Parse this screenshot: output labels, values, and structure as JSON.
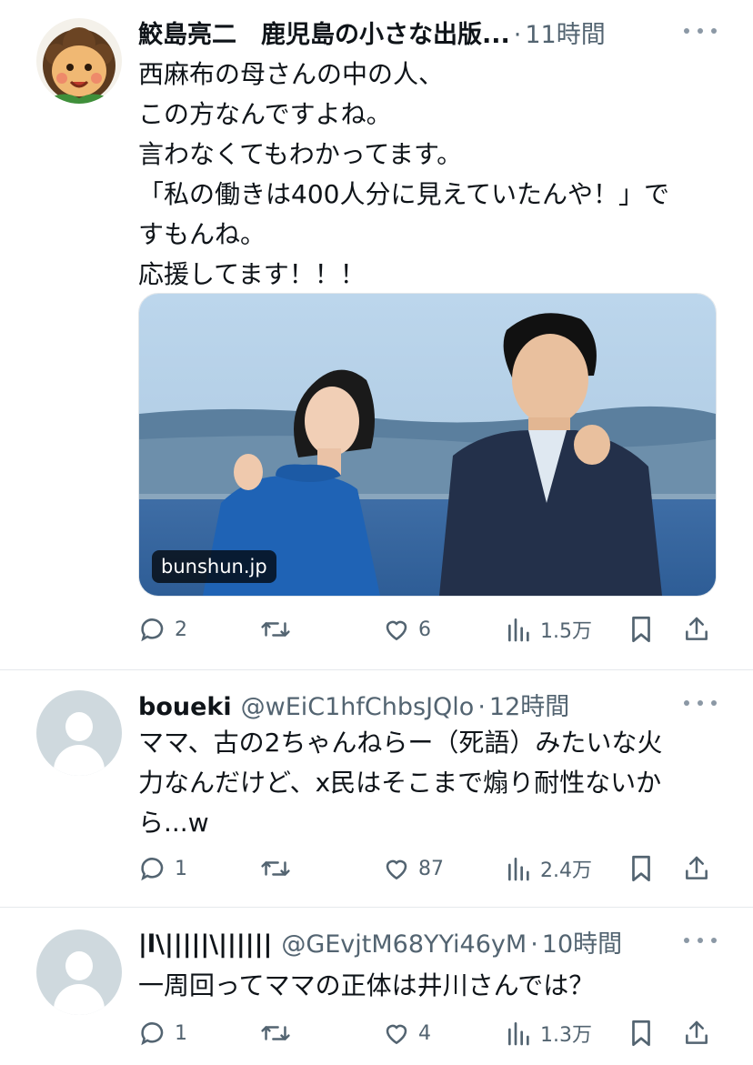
{
  "posts": [
    {
      "name": "鮫島亮二　鹿児島の小さな出版...",
      "handle": "",
      "separator": "·",
      "time": "11時間",
      "text": [
        "西麻布の母さんの中の人、",
        "この方なんですよね。",
        "言わなくてもわかってます。",
        "「私の働きは400人分に見えていたんや！」で",
        "すもんね。",
        "応援してます！！！"
      ],
      "card_domain": "bunshun.jp",
      "replies": "2",
      "reposts": "",
      "likes": "6",
      "views": "1.5万"
    },
    {
      "name": "boueki",
      "handle": "@wEiC1hfChbsJQlo",
      "separator": "·",
      "time": "12時間",
      "text": [
        "ママ、古の2ちゃんねらー（死語）みたいな火",
        "力なんだけど、x民はそこまで煽り耐性ないか",
        "ら...w"
      ],
      "replies": "1",
      "reposts": "",
      "likes": "87",
      "views": "2.4万"
    },
    {
      "name": "|l\\|||||\\||||||",
      "handle": "@GEvjtM68YYi46yM",
      "separator": "·",
      "time": "10時間",
      "text": [
        "一周回ってママの正体は井川さんでは？"
      ],
      "replies": "1",
      "reposts": "",
      "likes": "4",
      "views": "1.3万"
    }
  ],
  "icons": [
    "reply-icon",
    "repost-icon",
    "like-icon",
    "views-icon",
    "bookmark-icon",
    "share-icon",
    "more-icon",
    "avatar"
  ],
  "colors": {
    "text": "#0f1419",
    "secondary": "#536471",
    "divider": "#e6e9ec",
    "avatar_default": "#cfd9de"
  }
}
